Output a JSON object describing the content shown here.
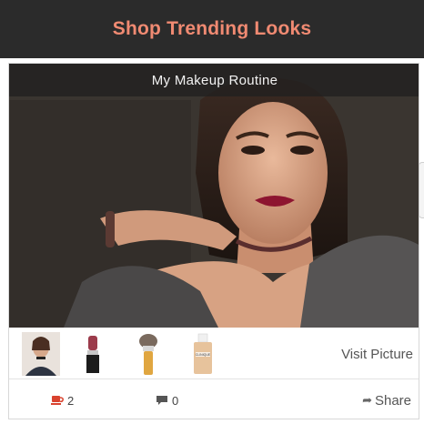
{
  "header": {
    "title": "Shop Trending Looks"
  },
  "post": {
    "caption": "My Makeup Routine",
    "visit_label": "Visit Picture",
    "likes": "2",
    "comments": "0",
    "share_label": "Share"
  },
  "products": [
    {
      "name": "choker-necklace"
    },
    {
      "name": "lipstick"
    },
    {
      "name": "makeup-brush"
    },
    {
      "name": "foundation-bottle",
      "label": "CLINIQUE"
    }
  ],
  "colors": {
    "header_bg": "#2b2b2b",
    "header_text": "#f08a72",
    "like_icon": "#d9432f"
  }
}
